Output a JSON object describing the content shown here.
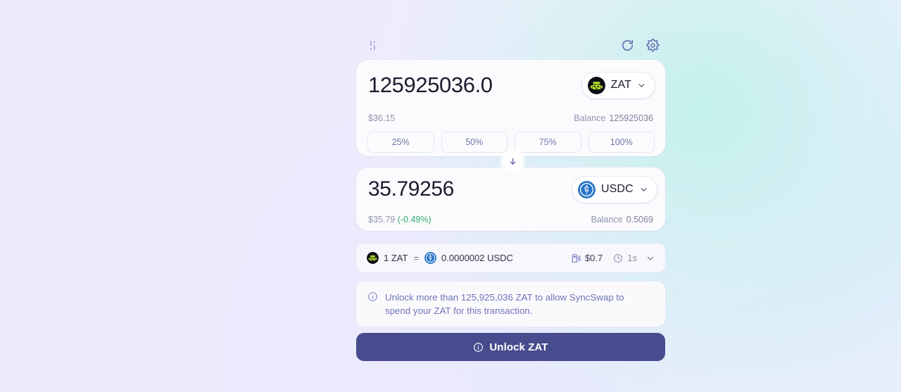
{
  "header": {
    "left_icon": "sliders-vertical-icon",
    "refresh_icon": "refresh-icon",
    "settings_icon": "gear-icon"
  },
  "from_card": {
    "amount": "125925036.0",
    "amount_placeholder": "0.0",
    "fiat_value": "$36.15",
    "balance_label": "Balance",
    "balance_value": "125925036",
    "token": {
      "symbol": "ZAT",
      "logo": "zat-token-icon"
    },
    "percent_buttons": [
      "25%",
      "50%",
      "75%",
      "100%"
    ]
  },
  "swap_direction": {
    "icon": "arrow-down-icon"
  },
  "to_card": {
    "amount": "35.79256",
    "amount_placeholder": "0.0",
    "fiat_value": "$35.79",
    "fiat_change": "(-0.49%)",
    "balance_label": "Balance",
    "balance_value": "0.5069",
    "token": {
      "symbol": "USDC",
      "logo": "usdc-token-icon"
    }
  },
  "rate_bar": {
    "base_amount": "1 ZAT",
    "equals": "=",
    "quote_amount": "0.0000002 USDC",
    "gas_icon": "gas-pump-icon",
    "gas_fee": "$0.7",
    "time_icon": "clock-icon",
    "time_estimate": "1s",
    "expand_icon": "chevron-down-icon"
  },
  "notice": {
    "icon": "info-circle-icon",
    "text": "Unlock more than 125,925,036 ZAT to allow SyncSwap to spend your ZAT for this transaction."
  },
  "primary_button": {
    "icon": "info-circle-icon",
    "label": "Unlock ZAT"
  },
  "colors": {
    "accent": "#474c8e",
    "notice_text": "#6f73b9",
    "positive_green": "#2eab6e",
    "muted": "#8f93ad",
    "background": "#eeebfd"
  }
}
